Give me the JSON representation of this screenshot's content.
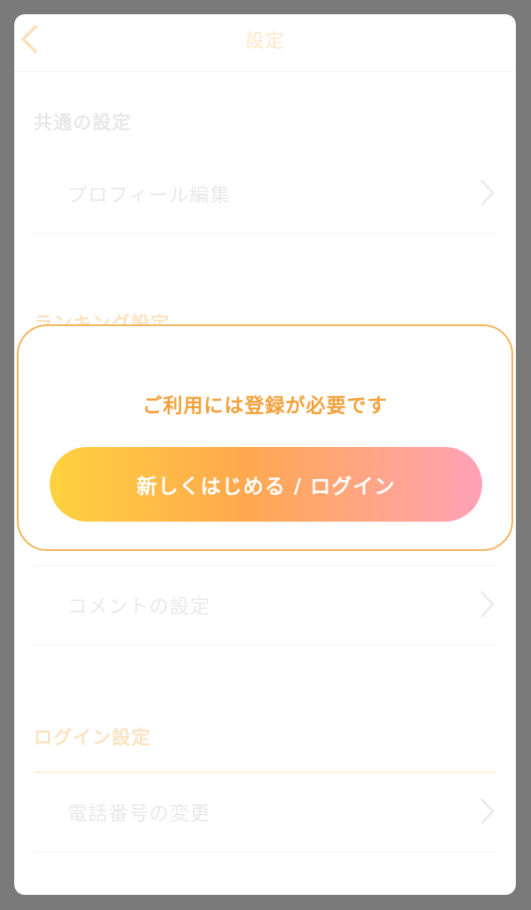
{
  "header": {
    "title": "設定",
    "back_icon": "chevron-left-icon"
  },
  "sections": {
    "common": {
      "title": "共通の設定",
      "items": [
        {
          "label": "プロフィール編集",
          "icon": "chevron-right-icon"
        }
      ]
    },
    "ranking": {
      "title": "ランキング設定",
      "items": [
        {
          "label": "コメントの設定",
          "icon": "chevron-right-icon"
        }
      ]
    },
    "login": {
      "title": "ログイン設定",
      "items": [
        {
          "label": "電話番号の変更",
          "icon": "chevron-right-icon"
        }
      ]
    }
  },
  "modal": {
    "message": "ご利用には登録が必要です",
    "button_label": "新しくはじめる / ログイン"
  },
  "colors": {
    "accent": "#f3a13c",
    "modal_border": "#f2b65e",
    "gradient_start": "#ffd23f",
    "gradient_mid": "#ffa84e",
    "gradient_end": "#ffa2b8",
    "overlay": "#7a7a7a"
  }
}
